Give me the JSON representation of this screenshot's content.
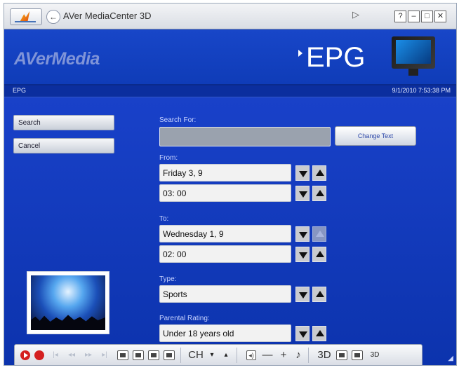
{
  "titlebar": {
    "app_title": "AVer MediaCenter 3D",
    "help_glyph": "?",
    "minimize_glyph": "–",
    "maximize_glyph": "□",
    "close_glyph": "✕",
    "back_glyph": "←",
    "cursor_glyph": "▷"
  },
  "header": {
    "logo": "AVerMedia",
    "page_title": "EPG"
  },
  "subbar": {
    "breadcrumb": "EPG",
    "datetime": "9/1/2010 7:53:38 PM"
  },
  "sidebar": {
    "search_label": "Search",
    "cancel_label": "Cancel"
  },
  "form": {
    "search_for_label": "Search For:",
    "search_value": "",
    "change_text_label": "Change Text",
    "from_label": "From:",
    "from_date": "Friday 3, 9",
    "from_time": "03: 00",
    "to_label": "To:",
    "to_date": "Wednesday 1, 9",
    "to_time": "02: 00",
    "type_label": "Type:",
    "type_value": "Sports",
    "rating_label": "Parental Rating:",
    "rating_value": "Under 18 years old"
  },
  "toolbar": {
    "ch_label": "CH",
    "down_glyph": "▾",
    "up_glyph": "▴",
    "minus_glyph": "—",
    "plus_glyph": "+",
    "music_glyph": "♪",
    "threed_label": "3D",
    "prev_glyph": "|◂",
    "rewind_glyph": "◂◂",
    "ff_glyph": "▸▸",
    "next_glyph": "▸|",
    "speaker_glyph": "◂)",
    "sd_glyph": "3D"
  },
  "colors": {
    "accent_blue": "#1846c8",
    "record_red": "#d42020"
  }
}
